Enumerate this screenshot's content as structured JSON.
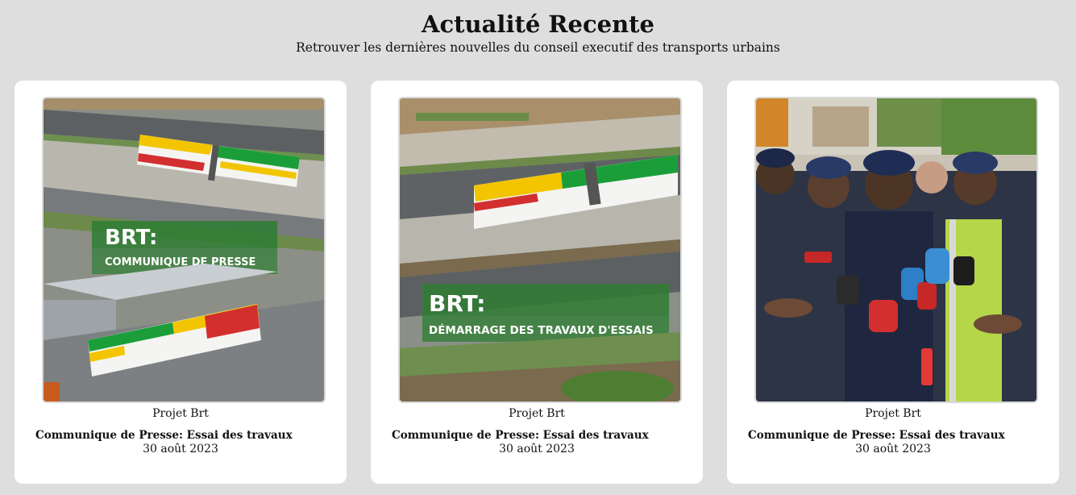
{
  "header": {
    "title": "Actualité Recente",
    "subtitle": "Retrouver les dernières nouvelles du conseil executif des transports urbains"
  },
  "cards": [
    {
      "category": "Projet Brt",
      "headline": "Communique de Presse: Essai des travaux",
      "date": "30 août 2023",
      "image": {
        "overlay_title": "BRT:",
        "overlay_subtitle": "COMMUNIQUE DE PRESSE"
      }
    },
    {
      "category": "Projet Brt",
      "headline": "Communique de Presse: Essai des travaux",
      "date": "30 août 2023",
      "image": {
        "overlay_title": "BRT:",
        "overlay_subtitle": "DÉMARRAGE DES TRAVAUX D'ESSAIS"
      }
    },
    {
      "category": "Projet Brt",
      "headline": "Communique de Presse: Essai des travaux",
      "date": "30 août 2023",
      "image": {}
    }
  ],
  "colors": {
    "page_background": "#dedede",
    "card_background": "#ffffff",
    "overlay_green": "#2e7d32",
    "bus_green": "#1b9e3a",
    "bus_yellow": "#f2c500",
    "bus_red": "#d32f2f"
  }
}
